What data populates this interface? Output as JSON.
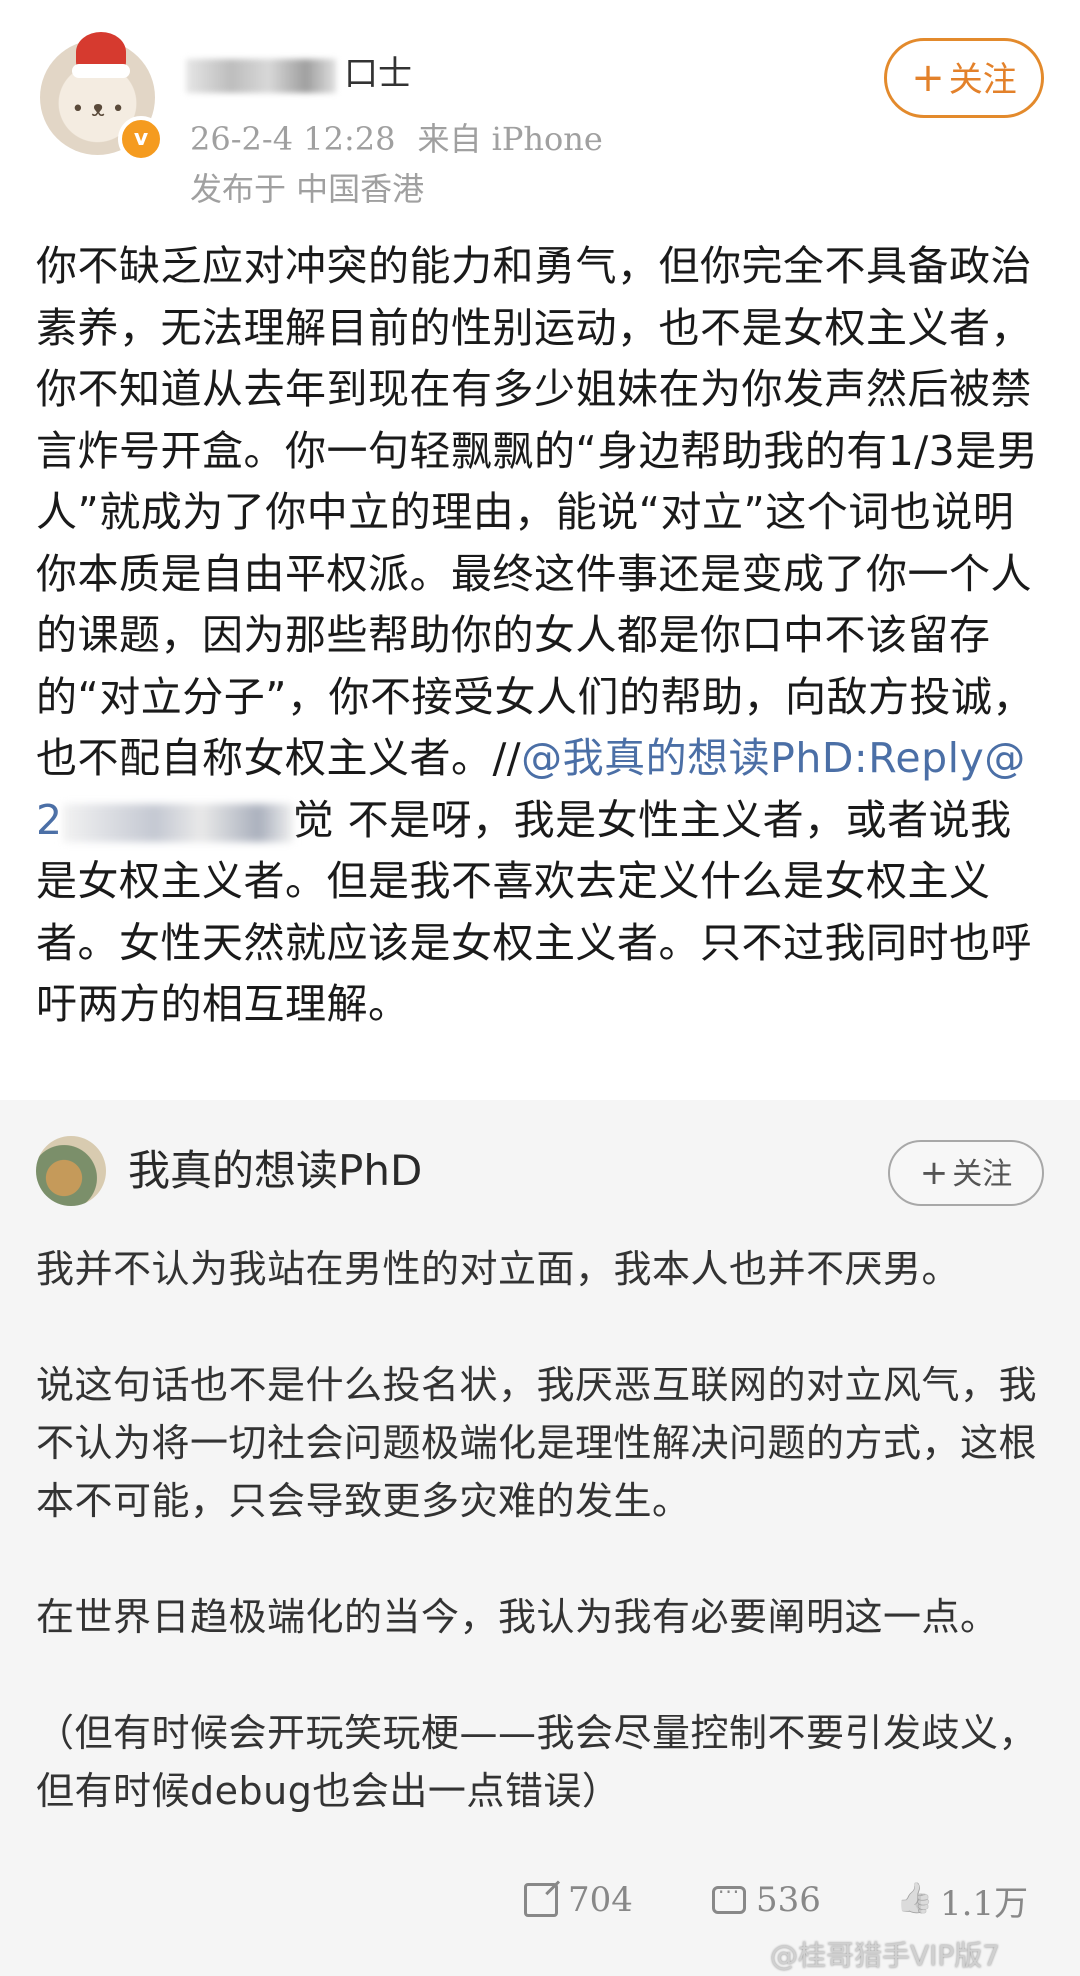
{
  "author": {
    "name_suffix": "口士",
    "timestamp": "26-2-4 12:28",
    "source": "来自 iPhone",
    "location": "发布于 中国香港",
    "follow_label": "关注",
    "follow_plus": "+"
  },
  "repost": {
    "text_before": "你不缺乏应对冲突的能力和勇气，但你完全不具备政治素养，无法理解目前的性别运动，也不是女权主义者，你不知道从去年到现在有多少姐妹在为你发声然后被禁言炸号开盒。你一句轻飘飘的“身边帮助我的有1/3是男人”就成为了你中立的理由，能说“对立”这个词也说明你本质是自由平权派。最终这件事还是变成了你一个人的课题，因为那些帮助你的女人都是你口中不该留存的“对立分子”，你不接受女人们的帮助，向敌方投诚，也不配自称女权主义者。//",
    "mention": "@我真的想读PhD",
    "text_reply": ":Reply@2",
    "text_after": "觉 不是呀，我是女性主义者，或者说我是女权主义者。但是我不喜欢去定义什么是女权主义者。女性天然就应该是女权主义者。只不过我同时也呼吁两方的相互理解。"
  },
  "quoted": {
    "username": "我真的想读PhD",
    "follow_label": "关注",
    "follow_plus": "+",
    "paragraphs": [
      "我并不认为我站在男性的对立面，我本人也并不厌男。",
      "说这句话也不是什么投名状，我厌恶互联网的对立风气，我不认为将一切社会问题极端化是理性解决问题的方式，这根本不可能，只会导致更多灾难的发生。",
      "在世界日趋极端化的当今，我认为我有必要阐明这一点。",
      "（但有时候会开玩笑玩梗——我会尽量控制不要引发歧义，但有时候debug也会出一点错误）"
    ]
  },
  "actions": {
    "repost_count": "704",
    "comment_count": "536",
    "like_count": "1.1万"
  },
  "watermark": "@桂哥猎手VIP版7"
}
